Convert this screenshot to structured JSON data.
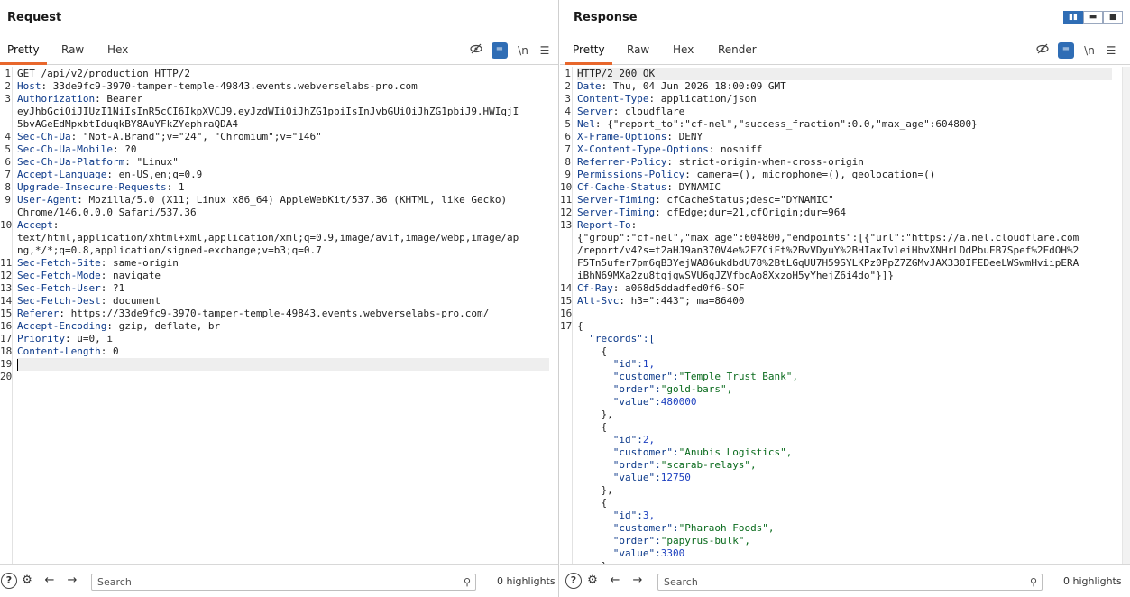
{
  "request": {
    "title": "Request",
    "tabs": [
      "Pretty",
      "Raw",
      "Hex"
    ],
    "active_tab": "Pretty",
    "line_numbers": [
      "1",
      "2",
      "3",
      "",
      "",
      "4",
      "5",
      "6",
      "7",
      "8",
      "9",
      "",
      "10",
      "",
      "",
      "11",
      "12",
      "13",
      "14",
      "15",
      "16",
      "17",
      "18",
      "19",
      "20"
    ],
    "lines": [
      {
        "plain": "GET /api/v2/production HTTP/2"
      },
      {
        "key": "Host",
        "val": "33de9fc9-3970-tamper-temple-49843.events.webverselabs-pro.com"
      },
      {
        "key": "Authorization",
        "val": "Bearer"
      },
      {
        "plain": "eyJhbGciOiJIUzI1NiIsInR5cCI6IkpXVCJ9.eyJzdWIiOiJhZG1pbiIsInJvbGUiOiJhZG1pbiJ9.HWIqjI"
      },
      {
        "plain": "5bvAGeEdMpxbtIduqkBY8AuYFkZYephraQDA4"
      },
      {
        "key": "Sec-Ch-Ua",
        "val": "\"Not-A.Brand\";v=\"24\", \"Chromium\";v=\"146\""
      },
      {
        "key": "Sec-Ch-Ua-Mobile",
        "val": "?0"
      },
      {
        "key": "Sec-Ch-Ua-Platform",
        "val": "\"Linux\""
      },
      {
        "key": "Accept-Language",
        "val": "en-US,en;q=0.9"
      },
      {
        "key": "Upgrade-Insecure-Requests",
        "val": "1"
      },
      {
        "key": "User-Agent",
        "val": "Mozilla/5.0 (X11; Linux x86_64) AppleWebKit/537.36 (KHTML, like Gecko)"
      },
      {
        "plain": "Chrome/146.0.0.0 Safari/537.36"
      },
      {
        "key": "Accept",
        "val": ""
      },
      {
        "plain": "text/html,application/xhtml+xml,application/xml;q=0.9,image/avif,image/webp,image/ap"
      },
      {
        "plain": "ng,*/*;q=0.8,application/signed-exchange;v=b3;q=0.7"
      },
      {
        "key": "Sec-Fetch-Site",
        "val": "same-origin"
      },
      {
        "key": "Sec-Fetch-Mode",
        "val": "navigate"
      },
      {
        "key": "Sec-Fetch-User",
        "val": "?1"
      },
      {
        "key": "Sec-Fetch-Dest",
        "val": "document"
      },
      {
        "key": "Referer",
        "val": "https://33de9fc9-3970-tamper-temple-49843.events.webverselabs-pro.com/"
      },
      {
        "key": "Accept-Encoding",
        "val": "gzip, deflate, br"
      },
      {
        "key": "Priority",
        "val": "u=0, i"
      },
      {
        "key": "Content-Length",
        "val": "0"
      },
      {
        "plain": ""
      },
      {
        "plain": ""
      }
    ],
    "search_placeholder": "Search",
    "highlights": "0 highlights"
  },
  "response": {
    "title": "Response",
    "tabs": [
      "Pretty",
      "Raw",
      "Hex",
      "Render"
    ],
    "active_tab": "Pretty",
    "line_numbers": [
      "1",
      "2",
      "3",
      "4",
      "5",
      "6",
      "7",
      "8",
      "9",
      "10",
      "11",
      "12",
      "13",
      "",
      "",
      "",
      "",
      "14",
      "15",
      "16",
      "17",
      "",
      "",
      "",
      "",
      "",
      "",
      "",
      "",
      "",
      "",
      "",
      "",
      "",
      "",
      "",
      "",
      "",
      "",
      "",
      ""
    ],
    "lines": [
      {
        "plain": "HTTP/2 200 OK"
      },
      {
        "key": "Date",
        "val": "Thu, 04 Jun 2026 18:00:09 GMT"
      },
      {
        "key": "Content-Type",
        "val": "application/json"
      },
      {
        "key": "Server",
        "val": "cloudflare"
      },
      {
        "key": "Nel",
        "val": "{\"report_to\":\"cf-nel\",\"success_fraction\":0.0,\"max_age\":604800}"
      },
      {
        "key": "X-Frame-Options",
        "val": "DENY"
      },
      {
        "key": "X-Content-Type-Options",
        "val": "nosniff"
      },
      {
        "key": "Referrer-Policy",
        "val": "strict-origin-when-cross-origin"
      },
      {
        "key": "Permissions-Policy",
        "val": "camera=(), microphone=(), geolocation=()"
      },
      {
        "key": "Cf-Cache-Status",
        "val": "DYNAMIC"
      },
      {
        "key": "Server-Timing",
        "val": "cfCacheStatus;desc=\"DYNAMIC\""
      },
      {
        "key": "Server-Timing",
        "val": "cfEdge;dur=21,cfOrigin;dur=964"
      },
      {
        "key": "Report-To",
        "val": ""
      },
      {
        "plain": "{\"group\":\"cf-nel\",\"max_age\":604800,\"endpoints\":[{\"url\":\"https://a.nel.cloudflare.com"
      },
      {
        "plain": "/report/v4?s=t2aHJ9an370V4e%2FZCiFt%2BvVDyuY%2BHIaxIvleiHbvXNHrLDdPbuEB7Spef%2FdOH%2"
      },
      {
        "plain": "F5Tn5ufer7pm6qB3YejWA86ukdbdU78%2BtLGqUU7H59SYLKPz0PpZ7ZGMvJAX330IFEDeeLWSwmHviipERA"
      },
      {
        "plain": "iBhN69MXa2zu8tgjgwSVU6gJZVfbqAo8XxzoH5yYhejZ6i4do\"}]}"
      },
      {
        "key": "Cf-Ray",
        "val": "a068d5ddadfed0f6-SOF"
      },
      {
        "key": "Alt-Svc",
        "val": "h3=\":443\"; ma=86400"
      },
      {
        "plain": ""
      },
      {
        "plain": "{"
      },
      {
        "json": "  \"records\":[",
        "kind": "key"
      },
      {
        "plain": "    {"
      },
      {
        "jk": "      \"id\":",
        "jv": "1,",
        "t": "n"
      },
      {
        "jk": "      \"customer\":",
        "jv": "\"Temple Trust Bank\",",
        "t": "s"
      },
      {
        "jk": "      \"order\":",
        "jv": "\"gold-bars\",",
        "t": "s"
      },
      {
        "jk": "      \"value\":",
        "jv": "480000",
        "t": "n"
      },
      {
        "plain": "    },"
      },
      {
        "plain": "    {"
      },
      {
        "jk": "      \"id\":",
        "jv": "2,",
        "t": "n"
      },
      {
        "jk": "      \"customer\":",
        "jv": "\"Anubis Logistics\",",
        "t": "s"
      },
      {
        "jk": "      \"order\":",
        "jv": "\"scarab-relays\",",
        "t": "s"
      },
      {
        "jk": "      \"value\":",
        "jv": "12750",
        "t": "n"
      },
      {
        "plain": "    },"
      },
      {
        "plain": "    {"
      },
      {
        "jk": "      \"id\":",
        "jv": "3,",
        "t": "n"
      },
      {
        "jk": "      \"customer\":",
        "jv": "\"Pharaoh Foods\",",
        "t": "s"
      },
      {
        "jk": "      \"order\":",
        "jv": "\"papyrus-bulk\",",
        "t": "s"
      },
      {
        "jk": "      \"value\":",
        "jv": "3300",
        "t": "n"
      },
      {
        "plain": "    },"
      },
      {
        "plain": ""
      }
    ],
    "search_placeholder": "Search",
    "highlights": "0 highlights"
  },
  "colors": {
    "accent": "#e8672c",
    "header_key": "#0d3a8a",
    "json_string": "#0a6b1d",
    "json_number": "#1c3fbf",
    "button_blue": "#2f6db5"
  }
}
